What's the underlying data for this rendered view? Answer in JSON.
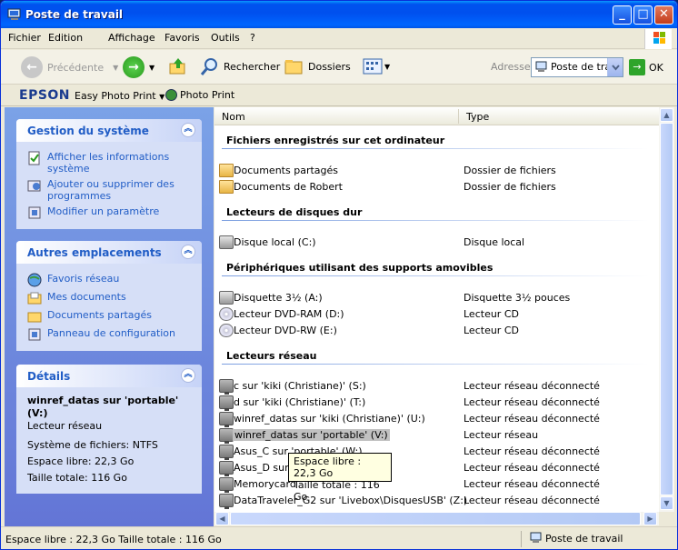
{
  "window": {
    "title": "Poste de travail"
  },
  "menu": [
    "Fichier",
    "Edition",
    "Affichage",
    "Favoris",
    "Outils",
    "?"
  ],
  "toolbar": {
    "back": "Précédente",
    "search": "Rechercher",
    "folders": "Dossiers",
    "address_label": "Adresse",
    "address_value": "Poste de travail",
    "go": "OK"
  },
  "epson": {
    "brand": "EPSON",
    "easy": "Easy Photo Print",
    "photo": "Photo Print"
  },
  "system_tasks": {
    "title": "Gestion du système",
    "links": [
      "Afficher les informations système",
      "Ajouter ou supprimer des programmes",
      "Modifier un paramètre"
    ]
  },
  "other_places": {
    "title": "Autres emplacements",
    "links": [
      "Favoris réseau",
      "Mes documents",
      "Documents partagés",
      "Panneau de configuration"
    ]
  },
  "details": {
    "title": "Détails",
    "name": "winref_datas sur 'portable' (V:)",
    "type": "Lecteur réseau",
    "fs": "Système de fichiers: NTFS",
    "free": "Espace libre: 22,3 Go",
    "total": "Taille totale: 116 Go"
  },
  "columns": {
    "name": "Nom",
    "type": "Type"
  },
  "groups": [
    {
      "title": "Fichiers enregistrés sur cet ordinateur",
      "items": [
        {
          "name": "Documents partagés",
          "type": "Dossier de fichiers",
          "icon": "folder"
        },
        {
          "name": "Documents de Robert",
          "type": "Dossier de fichiers",
          "icon": "folder"
        }
      ]
    },
    {
      "title": "Lecteurs de disques dur",
      "items": [
        {
          "name": "Disque local (C:)",
          "type": "Disque local",
          "icon": "disk"
        }
      ]
    },
    {
      "title": "Périphériques utilisant des supports amovibles",
      "items": [
        {
          "name": "Disquette 3½ (A:)",
          "type": "Disquette 3½ pouces",
          "icon": "floppy"
        },
        {
          "name": "Lecteur DVD-RAM (D:)",
          "type": "Lecteur CD",
          "icon": "cd"
        },
        {
          "name": "Lecteur DVD-RW (E:)",
          "type": "Lecteur CD",
          "icon": "cd"
        }
      ]
    },
    {
      "title": "Lecteurs réseau",
      "items": [
        {
          "name": "c sur 'kiki (Christiane)' (S:)",
          "type": "Lecteur réseau déconnecté",
          "icon": "netdrive"
        },
        {
          "name": "d sur 'kiki (Christiane)' (T:)",
          "type": "Lecteur réseau déconnecté",
          "icon": "netdrive"
        },
        {
          "name": "winref_datas sur 'kiki (Christiane)' (U:)",
          "type": "Lecteur réseau déconnecté",
          "icon": "netdrive"
        },
        {
          "name": "winref_datas sur 'portable' (V:)",
          "type": "Lecteur réseau",
          "icon": "netdrive",
          "selected": true
        },
        {
          "name": "Asus_C sur 'portable' (W:)",
          "type": "Lecteur réseau déconnecté",
          "icon": "netdrive"
        },
        {
          "name": "Asus_D sur 'p",
          "type": "Lecteur réseau déconnecté",
          "icon": "netdrive"
        },
        {
          "name": "Memorycard",
          "type": "Lecteur réseau déconnecté",
          "icon": "netdrive"
        },
        {
          "name": "DataTraveler_G2 sur 'Livebox\\DisquesUSB' (Z:)",
          "type": "Lecteur réseau déconnecté",
          "icon": "netdrive"
        }
      ]
    }
  ],
  "tooltip": {
    "line1": "Espace libre : 22,3 Go",
    "line2": "Taille totale : 116 Go"
  },
  "status": {
    "left": "Espace libre : 22,3 Go Taille totale : 116 Go",
    "right": "Poste de travail"
  }
}
